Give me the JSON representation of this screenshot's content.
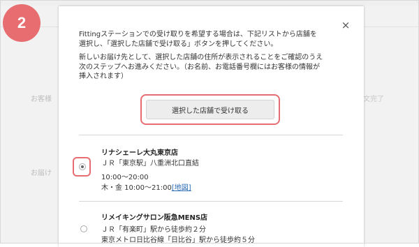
{
  "step": {
    "number": "2"
  },
  "background": {
    "left_label_1": "お客様",
    "left_label_2": "お届け",
    "right_label_1": "ご注文完了"
  },
  "modal": {
    "close_label": "×",
    "intro_paragraph_1_line_1": "Fittingステーションでの受け取りを希望する場合は、下記リストから店舗を",
    "intro_paragraph_1_line_2": "選択し、「選択した店舗で受け取る」ボタンを押してください。",
    "intro_paragraph_2_line_1": "新しいお届け先として、選択した店舗の住所が表示されることをご確認のうえ",
    "intro_paragraph_2_line_2": "次のステップへお進みください。（お名前、お電話番号欄にはお客様の情報が",
    "intro_paragraph_2_line_3": "挿入されます）",
    "select_button_label": "選択した店舗で受け取る"
  },
  "stores": [
    {
      "name": "リナシェーレ大丸東京店",
      "access_1": "ＪＲ「東京駅」八重洲北口直結",
      "hours_1": "10:00〜20:00",
      "hours_2_prefix": "木・金 10:00〜21:00",
      "map_link": "[地図]",
      "selected": true
    },
    {
      "name": "リメイキングサロン阪急MENS店",
      "access_1": "ＪＲ「有楽町」駅から徒歩約２分",
      "access_2": "東京メトロ日比谷線「日比谷」駅から徒歩約５分",
      "selected": false
    }
  ],
  "colors": {
    "accent": "#e76d70",
    "link": "#2a6bb8",
    "button_bg": "#ededed"
  }
}
